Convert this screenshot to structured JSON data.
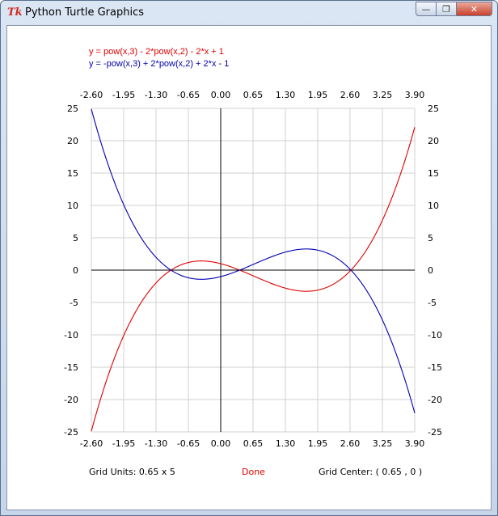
{
  "window": {
    "title": "Python Turtle Graphics",
    "app_icon": "Tk",
    "min_glyph": "—",
    "max_glyph": "❐",
    "close_glyph": "✕"
  },
  "legend": {
    "red_equation": "y = pow(x,3) - 2*pow(x,2) - 2*x + 1",
    "blue_equation": "y = -pow(x,3) + 2*pow(x,2) + 2*x - 1"
  },
  "footer": {
    "grid_units": "Grid Units:  0.65  x  5",
    "status": "Done",
    "grid_center": "Grid Center: (  0.65 ,  0 )"
  },
  "colors": {
    "red": "#e00000",
    "blue": "#0000b0",
    "grid": "#d0d0d0",
    "axis": "#000000"
  },
  "chart_data": {
    "type": "line",
    "x_ticks": [
      "-2.60",
      "-1.95",
      "-1.30",
      "-0.65",
      "0.00",
      "0.65",
      "1.30",
      "1.95",
      "2.60",
      "3.25",
      "3.90"
    ],
    "y_ticks": [
      "25",
      "20",
      "15",
      "10",
      "5",
      "0",
      "-5",
      "-10",
      "-15",
      "-20",
      "-25"
    ],
    "xlim": [
      -2.6,
      3.9
    ],
    "ylim": [
      -25,
      25
    ],
    "grid": true,
    "series": [
      {
        "name": "y = pow(x,3) - 2*pow(x,2) - 2*x + 1",
        "color": "#e00000",
        "coefficients": [
          1,
          -2,
          -2,
          1
        ]
      },
      {
        "name": "y = -pow(x,3) + 2*pow(x,2) + 2*x - 1",
        "color": "#0000b0",
        "coefficients": [
          -1,
          2,
          2,
          -1
        ]
      }
    ]
  }
}
